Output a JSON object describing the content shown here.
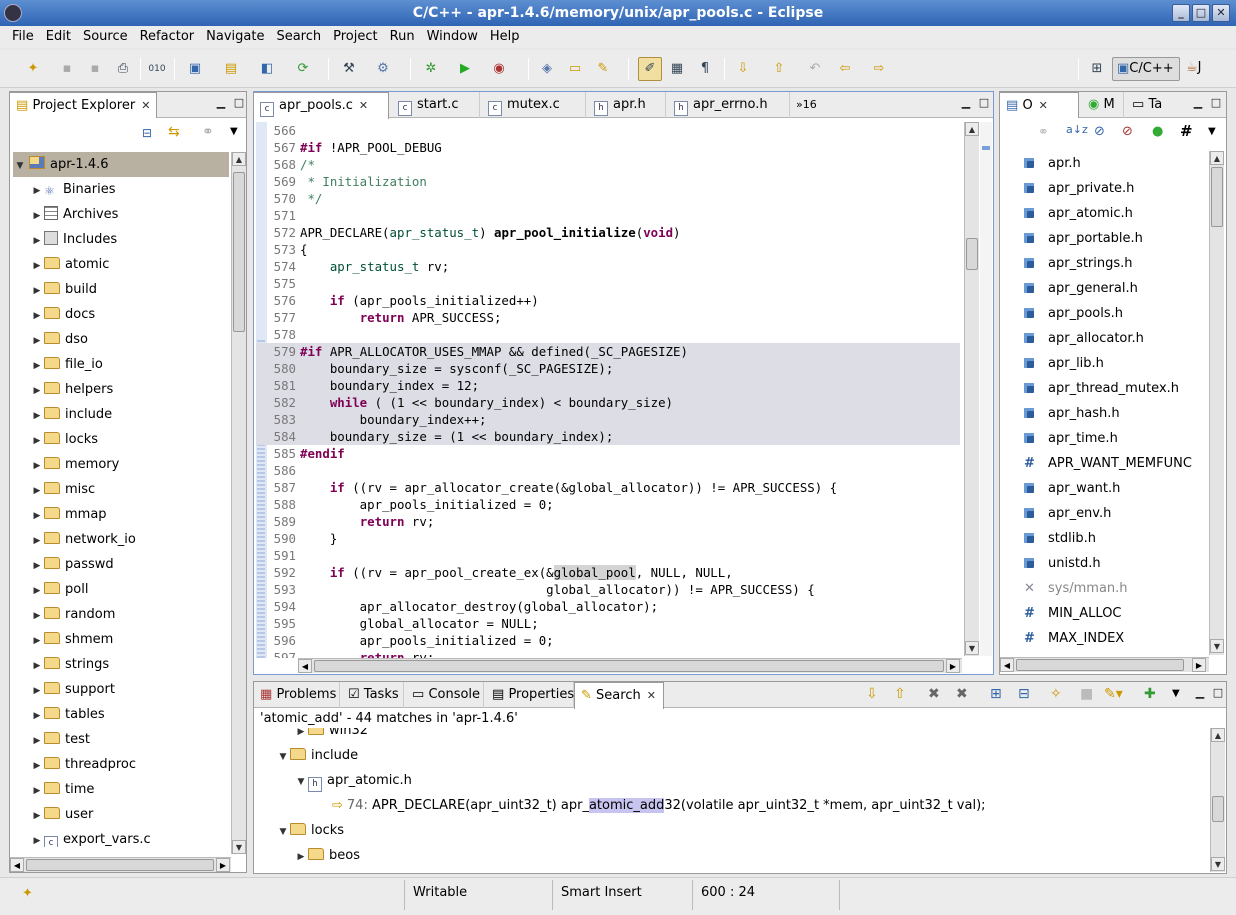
{
  "window": {
    "title": "C/C++ - apr-1.4.6/memory/unix/apr_pools.c - Eclipse"
  },
  "menu": [
    "File",
    "Edit",
    "Source",
    "Refactor",
    "Navigate",
    "Search",
    "Project",
    "Run",
    "Window",
    "Help"
  ],
  "perspective": {
    "label": "C/C++",
    "short": "J"
  },
  "project_explorer": {
    "tab": "Project Explorer",
    "root": "apr-1.4.6",
    "items": [
      {
        "label": "Binaries",
        "icon": "binaries-icon"
      },
      {
        "label": "Archives",
        "icon": "archives-icon"
      },
      {
        "label": "Includes",
        "icon": "includes-icon"
      },
      {
        "label": "atomic",
        "icon": "folder-icon"
      },
      {
        "label": "build",
        "icon": "folder-icon"
      },
      {
        "label": "docs",
        "icon": "folder-icon"
      },
      {
        "label": "dso",
        "icon": "folder-icon"
      },
      {
        "label": "file_io",
        "icon": "folder-icon"
      },
      {
        "label": "helpers",
        "icon": "folder-icon"
      },
      {
        "label": "include",
        "icon": "folder-icon"
      },
      {
        "label": "locks",
        "icon": "folder-icon"
      },
      {
        "label": "memory",
        "icon": "folder-icon"
      },
      {
        "label": "misc",
        "icon": "folder-icon"
      },
      {
        "label": "mmap",
        "icon": "folder-icon"
      },
      {
        "label": "network_io",
        "icon": "folder-icon"
      },
      {
        "label": "passwd",
        "icon": "folder-icon"
      },
      {
        "label": "poll",
        "icon": "folder-icon"
      },
      {
        "label": "random",
        "icon": "folder-icon"
      },
      {
        "label": "shmem",
        "icon": "folder-icon"
      },
      {
        "label": "strings",
        "icon": "folder-icon"
      },
      {
        "label": "support",
        "icon": "folder-icon"
      },
      {
        "label": "tables",
        "icon": "folder-icon"
      },
      {
        "label": "test",
        "icon": "folder-icon"
      },
      {
        "label": "threadproc",
        "icon": "folder-icon"
      },
      {
        "label": "time",
        "icon": "folder-icon"
      },
      {
        "label": "user",
        "icon": "folder-icon"
      },
      {
        "label": "export_vars.c",
        "icon": "c-file-icon"
      }
    ]
  },
  "editor": {
    "tabs": [
      {
        "label": "apr_pools.c",
        "icon": "c",
        "active": true
      },
      {
        "label": "start.c",
        "icon": "c"
      },
      {
        "label": "mutex.c",
        "icon": "c"
      },
      {
        "label": "apr.h",
        "icon": "h"
      },
      {
        "label": "apr_errno.h",
        "icon": "h"
      }
    ],
    "overflow": "»16",
    "lines": [
      {
        "n": "566",
        "html": ""
      },
      {
        "n": "567",
        "html": "<span class='pp'>#if</span> !APR_POOL_DEBUG"
      },
      {
        "n": "568",
        "html": "<span class='cm'>/*</span>"
      },
      {
        "n": "569",
        "html": "<span class='cm'> * Initialization</span>"
      },
      {
        "n": "570",
        "html": "<span class='cm'> */</span>"
      },
      {
        "n": "571",
        "html": ""
      },
      {
        "n": "572",
        "html": "APR_DECLARE(<span class='ty'>apr_status_t</span>) <span class='fn'>apr_pool_initialize</span>(<span class='kw'>void</span>)"
      },
      {
        "n": "573",
        "html": "{"
      },
      {
        "n": "574",
        "html": "    <span class='ty'>apr_status_t</span> rv;"
      },
      {
        "n": "575",
        "html": ""
      },
      {
        "n": "576",
        "html": "    <span class='kw'>if</span> (apr_pools_initialized++)"
      },
      {
        "n": "577",
        "html": "        <span class='kw'>return</span> APR_SUCCESS;"
      },
      {
        "n": "578",
        "html": ""
      },
      {
        "n": "579",
        "html": "<span class='pp'>#if</span> APR_ALLOCATOR_USES_MMAP &amp;&amp; defined(_SC_PAGESIZE)",
        "hl": true
      },
      {
        "n": "580",
        "html": "    boundary_size = sysconf(_SC_PAGESIZE);",
        "hl": true
      },
      {
        "n": "581",
        "html": "    boundary_index = 12;",
        "hl": true
      },
      {
        "n": "582",
        "html": "    <span class='kw'>while</span> ( (1 &lt;&lt; boundary_index) &lt; boundary_size)",
        "hl": true
      },
      {
        "n": "583",
        "html": "        boundary_index++;",
        "hl": true
      },
      {
        "n": "584",
        "html": "    boundary_size = (1 &lt;&lt; boundary_index);",
        "hl": true
      },
      {
        "n": "585",
        "html": "<span class='pp'>#endif</span>"
      },
      {
        "n": "586",
        "html": ""
      },
      {
        "n": "587",
        "html": "    <span class='kw'>if</span> ((rv = apr_allocator_create(&amp;global_allocator)) != APR_SUCCESS) {"
      },
      {
        "n": "588",
        "html": "        apr_pools_initialized = 0;"
      },
      {
        "n": "589",
        "html": "        <span class='kw'>return</span> rv;"
      },
      {
        "n": "590",
        "html": "    }"
      },
      {
        "n": "591",
        "html": ""
      },
      {
        "n": "592",
        "html": "    <span class='kw'>if</span> ((rv = apr_pool_create_ex(&amp;<span style='background:#d4d4d4'>global_pool</span>, NULL, NULL,"
      },
      {
        "n": "593",
        "html": "                                 global_allocator)) != APR_SUCCESS) {"
      },
      {
        "n": "594",
        "html": "        apr_allocator_destroy(global_allocator);"
      },
      {
        "n": "595",
        "html": "        global_allocator = NULL;"
      },
      {
        "n": "596",
        "html": "        apr_pools_initialized = 0;"
      },
      {
        "n": "597",
        "html": "        <span class='kw'>return</span> rv;"
      }
    ]
  },
  "outline": {
    "tabs": [
      "O",
      "M",
      "Ta"
    ],
    "items": [
      {
        "label": "apr.h",
        "kind": "include"
      },
      {
        "label": "apr_private.h",
        "kind": "include"
      },
      {
        "label": "apr_atomic.h",
        "kind": "include"
      },
      {
        "label": "apr_portable.h",
        "kind": "include"
      },
      {
        "label": "apr_strings.h",
        "kind": "include"
      },
      {
        "label": "apr_general.h",
        "kind": "include"
      },
      {
        "label": "apr_pools.h",
        "kind": "include"
      },
      {
        "label": "apr_allocator.h",
        "kind": "include"
      },
      {
        "label": "apr_lib.h",
        "kind": "include"
      },
      {
        "label": "apr_thread_mutex.h",
        "kind": "include"
      },
      {
        "label": "apr_hash.h",
        "kind": "include"
      },
      {
        "label": "apr_time.h",
        "kind": "include"
      },
      {
        "label": "APR_WANT_MEMFUNC",
        "kind": "define"
      },
      {
        "label": "apr_want.h",
        "kind": "include"
      },
      {
        "label": "apr_env.h",
        "kind": "include"
      },
      {
        "label": "stdlib.h",
        "kind": "include"
      },
      {
        "label": "unistd.h",
        "kind": "include"
      },
      {
        "label": "sys/mman.h",
        "kind": "inactive"
      },
      {
        "label": "MIN_ALLOC",
        "kind": "define"
      },
      {
        "label": "MAX_INDEX",
        "kind": "define"
      }
    ]
  },
  "bottom": {
    "tabs": [
      "Problems",
      "Tasks",
      "Console",
      "Properties",
      "Search"
    ],
    "summary": "'atomic_add' - 44 matches in 'apr-1.4.6'",
    "results": {
      "win32": "win32",
      "include": "include",
      "file": "apr_atomic.h",
      "match_line": "74:",
      "match_pre": "APR_DECLARE(apr_uint32_t) apr_",
      "match_hit": "atomic_add",
      "match_post": "32(volatile apr_uint32_t *mem, apr_uint32_t val);",
      "locks": "locks",
      "beos": "beos"
    }
  },
  "status": {
    "mode": "Writable",
    "insert": "Smart Insert",
    "position": "600 : 24"
  }
}
